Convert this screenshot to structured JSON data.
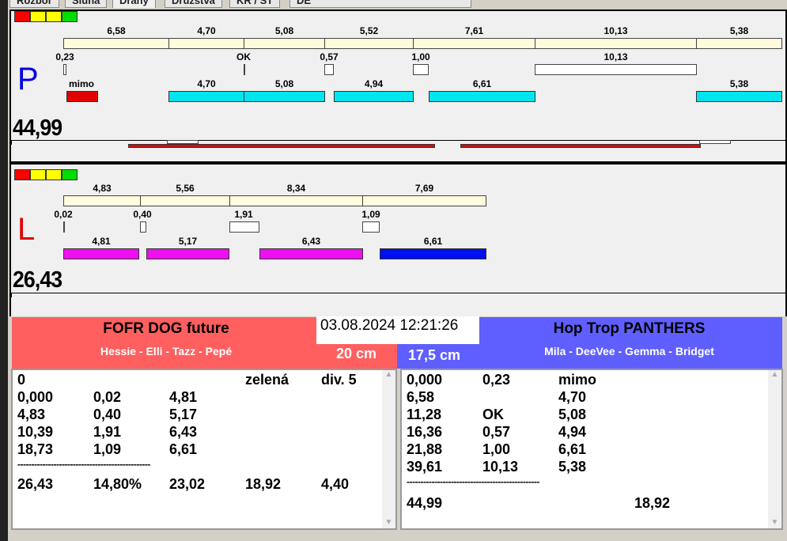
{
  "tabs": [
    "Rozbor",
    "Sluha",
    "Dráhy",
    "Družstva",
    "KR / ST",
    "DE"
  ],
  "lamp_colors": [
    "#ff0000",
    "#ffff00",
    "#ffff00",
    "#00dd00"
  ],
  "p": {
    "side": "P",
    "total": "44,99",
    "row1": [
      "6,58",
      "4,70",
      "5,08",
      "5,52",
      "7,61",
      "10,13",
      "5,38"
    ],
    "row2": [
      "0,23",
      "OK",
      "0,57",
      "1,00",
      "10,13"
    ],
    "row3": [
      "mimo",
      "4,70",
      "5,08",
      "4,94",
      "6,61",
      "5,38"
    ]
  },
  "l": {
    "side": "L",
    "total": "26,43",
    "row1": [
      "4,83",
      "5,56",
      "8,34",
      "7,69"
    ],
    "row2": [
      "0,02",
      "0,40",
      "1,91",
      "1,09"
    ],
    "row3": [
      "4,81",
      "5,17",
      "6,43",
      "6,61"
    ]
  },
  "datetime": "03.08.2024 12:21:26",
  "left_team": {
    "name": "FOFR DOG future",
    "members": "Hessie - Elli - Tazz - Pepé",
    "height": "20 cm",
    "color": "#ff5f5f",
    "rows": [
      [
        "0",
        "",
        "",
        "zelená",
        "div. 5"
      ],
      [
        "0,000",
        "0,02",
        "4,81",
        "",
        ""
      ],
      [
        "4,83",
        "0,40",
        "5,17",
        "",
        ""
      ],
      [
        "10,39",
        "1,91",
        "6,43",
        "",
        ""
      ],
      [
        "18,73",
        "1,09",
        "6,61",
        "",
        ""
      ]
    ],
    "separator": "------------------------------------------------",
    "summary": [
      "26,43",
      "14,80%",
      "23,02",
      "18,92",
      "4,40"
    ]
  },
  "right_team": {
    "name": "Hop Trop PANTHERS",
    "members": "Mila - DeeVee - Gemma - Bridget",
    "height": "17,5 cm",
    "color": "#5f5fff",
    "rows": [
      [
        "0,000",
        "0,23",
        "mimo"
      ],
      [
        "6,58",
        "",
        "4,70"
      ],
      [
        "11,28",
        "OK",
        "5,08"
      ],
      [
        "16,36",
        "0,57",
        "4,94"
      ],
      [
        "21,88",
        "1,00",
        "6,61"
      ],
      [
        "39,61",
        "10,13",
        "5,38"
      ]
    ],
    "separator": "------------------------------------------------",
    "summary": [
      "44,99",
      "18,92"
    ]
  }
}
